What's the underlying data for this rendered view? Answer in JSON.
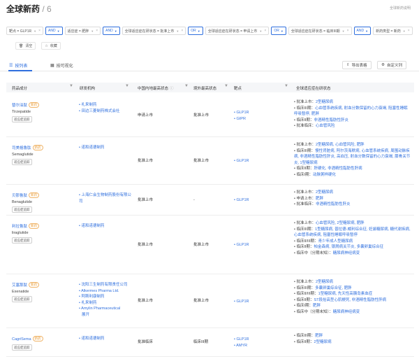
{
  "header": {
    "title": "全球新药",
    "count": "/ 6",
    "help_link": "全球新药说明"
  },
  "filters": {
    "chips": [
      {
        "label": "靶点 = GLP1R",
        "op": "AND"
      },
      {
        "label": "适应症 = 肥胖",
        "op": "AND"
      },
      {
        "label": "全球适应症在研状态 = 批准上市",
        "op": "OR"
      },
      {
        "label": "全球适应症在研状态 = 申请上市",
        "op": "OR"
      },
      {
        "label": "全球适应症在研状态 = 临床III期",
        "op": "AND"
      },
      {
        "label": "新药类型 = 新药",
        "op": ""
      }
    ],
    "clear_label": "清空",
    "save_label": "收藏"
  },
  "tabs": [
    {
      "label": "按列表"
    },
    {
      "label": "按可视化"
    }
  ],
  "toolbar": {
    "export_label": "导出表格",
    "custom_label": "自定义列"
  },
  "columns": [
    "药品成分",
    "研发机构",
    "中国内地最高状态",
    "境外最高状态",
    "靶点",
    "全球适应症在研状态"
  ],
  "follow_label": "适应症追踪",
  "new_badge": "新药",
  "rows": [
    {
      "drug_cn": "替尔泊肽",
      "drug_en": "Tirzepatide",
      "orgs": [
        "礼来制药",
        "田边三菱制药株式会社"
      ],
      "cn_status": "申请上市",
      "intl_status": "批准上市",
      "targets": [
        "GLP1R",
        "GIPR"
      ],
      "statuses": [
        {
          "label": "批准上市：",
          "value": "2型糖尿病"
        },
        {
          "label": "临床III期：",
          "value": "心血管系统疾病, 射血分数保留的心力衰竭, 阻塞性睡眠呼吸暂停, 肥胖"
        },
        {
          "label": "临床II期：",
          "value": "非酒精性脂肪性肝炎"
        },
        {
          "label": "批准临床：",
          "value": "心血管风险"
        }
      ]
    },
    {
      "drug_cn": "司美格鲁肽",
      "drug_en": "Semaglutide",
      "orgs": [
        "诺和诺德制药"
      ],
      "cn_status": "批准上市",
      "intl_status": "批准上市",
      "targets": [
        "GLP1R"
      ],
      "statuses": [
        {
          "label": "批准上市：",
          "value": "2型糖尿病, 心血管风险, 肥胖"
        },
        {
          "label": "临床III期：",
          "value": "慢性肾脏病, 阿尔茨海默病, 心血管系统疾病, 周围动脉疾病, 非酒精性脂肪性肝炎, 高血压, 射血分数保留的心力衰竭, 膝骨关节炎, 1型糖尿病"
        },
        {
          "label": "临床II期：",
          "value": "肝硬化, 非酒精性脂肪性肝病"
        },
        {
          "label": "临床I期：",
          "value": "动脉粥样硬化"
        }
      ]
    },
    {
      "drug_cn": "贝那鲁肽",
      "drug_en": "Benaglutide",
      "orgs": [
        "上海仁会生物制药股份有限公司"
      ],
      "cn_status": "批准上市",
      "intl_status": "-",
      "targets": [
        "GLP1R"
      ],
      "statuses": [
        {
          "label": "批准上市：",
          "value": "2型糖尿病"
        },
        {
          "label": "申请上市：",
          "value": "肥胖"
        },
        {
          "label": "批准临床：",
          "value": "非酒精性脂肪性肝炎"
        }
      ]
    },
    {
      "drug_cn": "利拉鲁肽",
      "drug_en": "liraglutide",
      "orgs": [
        "诺和诺德制药"
      ],
      "cn_status": "批准上市",
      "intl_status": "批准上市",
      "targets": [
        "GLP1R"
      ],
      "statuses": [
        {
          "label": "批准上市：",
          "value": "心血管风险, 2型糖尿病, 肥胖"
        },
        {
          "label": "临床III期：",
          "value": "1型糖尿病, 普拉德-威利综合征, 妊娠糖尿病, 糖代谢疾病, 心血管系统疾病, 阻塞性睡眠呼吸暂停"
        },
        {
          "label": "临床II/III期：",
          "value": "青少年成人型糖尿病"
        },
        {
          "label": "临床II期：",
          "value": "帕金森病, 银屑病关节炎, 多囊卵巢综合征"
        },
        {
          "label": "临床中（分期未知）：",
          "value": "糖尿病神经病变"
        }
      ]
    },
    {
      "drug_cn": "艾塞那肽",
      "drug_en": "Exenatide",
      "orgs": [
        "沈阳三生制药有限责任公司",
        "Alkermes Pharma Ltd.",
        "阿斯利康制药",
        "礼来制药",
        "Amylin Pharmaceutical"
      ],
      "orgs_more": "展开",
      "cn_status": "批准上市",
      "intl_status": "批准上市",
      "targets": [
        "GLP1R"
      ],
      "statuses": [
        {
          "label": "批准上市：",
          "value": "2型糖尿病"
        },
        {
          "label": "临床III期：",
          "value": "多囊卵巢综合征, 肥胖"
        },
        {
          "label": "临床II/III期：",
          "value": "1型糖尿病, 先天性高胰岛素血症"
        },
        {
          "label": "临床II期：",
          "value": "ST段抬高型心肌梗死, 非酒精性脂肪性肝病"
        },
        {
          "label": "临床I期：",
          "value": "肥胖"
        },
        {
          "label": "临床中（分期未知）：",
          "value": "糖尿病神经病变"
        }
      ]
    },
    {
      "drug_cn": "CagriSema",
      "drug_en": "",
      "orgs": [
        "诺和诺德制药"
      ],
      "cn_status": "批准临床",
      "intl_status": "临床III期",
      "targets": [
        "GLP1R",
        "AMYR"
      ],
      "statuses": [
        {
          "label": "临床III期：",
          "value": "肥胖"
        },
        {
          "label": "临床II期：",
          "value": "2型糖尿病"
        }
      ]
    }
  ]
}
